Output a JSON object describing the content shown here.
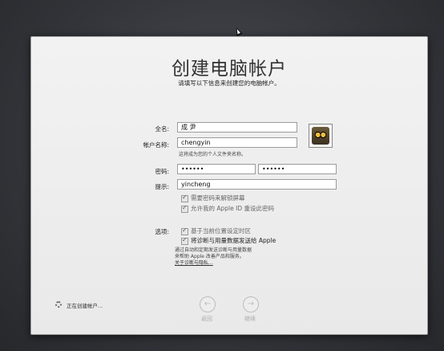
{
  "header": {
    "title": "创建电脑帐户",
    "subtitle": "请填写以下信息来创建您的电脑帐户。"
  },
  "form": {
    "full_name": {
      "label": "全名:",
      "value": "成 尹"
    },
    "account_name": {
      "label": "帐户名称:",
      "value": "chengyin",
      "hint": "这将成为您的个人文件夹名称。"
    },
    "password": {
      "label": "密码:",
      "value": "••••••",
      "verify_value": "••••••"
    },
    "hint": {
      "label": "提示:",
      "value": "yincheng"
    },
    "password_options": [
      {
        "label": "需要密码来解锁屏幕",
        "checked": true
      },
      {
        "label": "允许我的 Apple ID 重设此密码",
        "checked": true
      }
    ],
    "options_label": "选项:",
    "options": [
      {
        "label": "基于当前位置设定时区",
        "checked": true
      },
      {
        "label": "将诊断与用量数据发送给 Apple",
        "checked": true
      }
    ],
    "info_lines": [
      "通过自动和定期发送诊断与用量数据",
      "来帮助 Apple 改善产品和服务。"
    ],
    "info_link": "关于诊断与隐私..."
  },
  "footer": {
    "status": "正在创建帐户...",
    "back_label": "返回",
    "continue_label": "继续",
    "back_icon": "arrow-left-icon",
    "continue_icon": "arrow-right-icon"
  },
  "avatar_icon": "owl-avatar-icon"
}
